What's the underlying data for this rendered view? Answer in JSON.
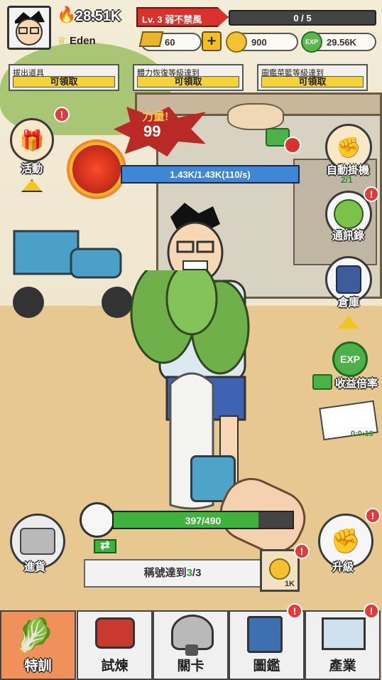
{
  "player": {
    "name": "Eden",
    "power": "28.51K"
  },
  "level": {
    "label": "Lv. 3 弱不禁風",
    "progress_text": "0 / 5",
    "progress": 0.0
  },
  "currencies": {
    "gold_bars": "60",
    "coins": "900",
    "exp": "29.56K"
  },
  "tasks": [
    {
      "title": "拔出道具",
      "action": "可領取"
    },
    {
      "title": "體力恢復等級達到",
      "action": "可領取"
    },
    {
      "title": "圖鑑菜籃等級達到",
      "action": "可領取"
    }
  ],
  "strength": {
    "label": "力量!",
    "value": "99"
  },
  "stamina": {
    "text": "1.43K/1.43K(110/s)",
    "progress": 1.0
  },
  "left_menu": {
    "activity": "活動",
    "restock": "進貨"
  },
  "right_menu": {
    "auto": "自動掛機",
    "auto_count": "2/1",
    "contacts": "通訊錄",
    "warehouse": "倉庫",
    "income": "收益倍率",
    "timer": "0:0:16",
    "upgrade": "升級"
  },
  "radish": {
    "hp_text": "397/490",
    "progress": 0.81
  },
  "title_goal": {
    "prefix": "稱號達到",
    "current": "3",
    "total": "/3"
  },
  "coin_box": {
    "label": "1K"
  },
  "tabs": [
    "特訓",
    "試煉",
    "關卡",
    "圖鑑",
    "產業"
  ],
  "colors": {
    "accent_red": "#d9312b",
    "stamina_blue": "#3f86d6",
    "hp_green": "#3db23d",
    "tab_active": "#f0905a"
  }
}
